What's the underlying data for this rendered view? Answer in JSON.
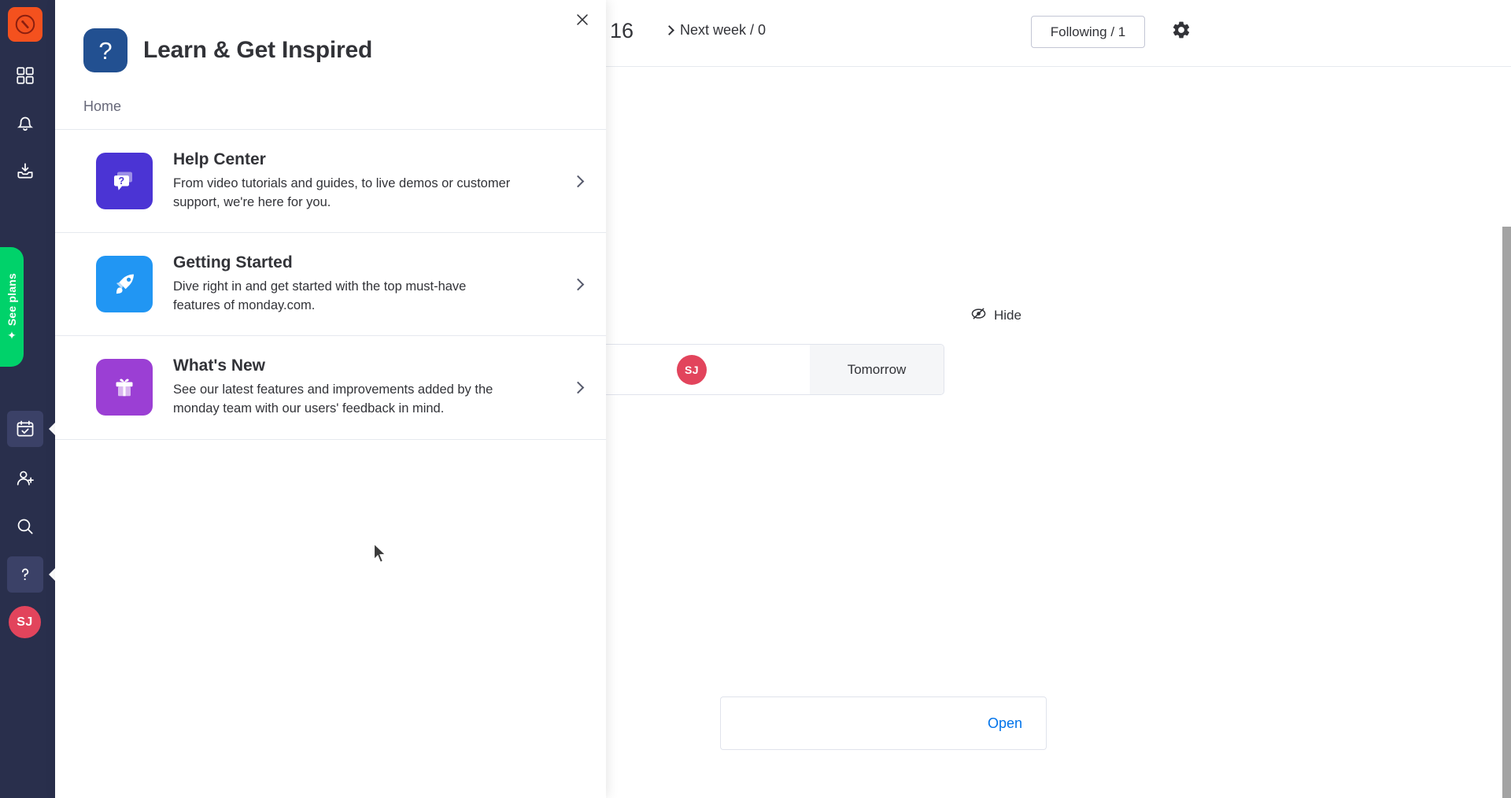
{
  "rail": {
    "logo_icon": "monday-logo-icon",
    "items": [
      {
        "name": "sidebar-item-home",
        "icon": "grid-icon",
        "active": false
      },
      {
        "name": "sidebar-item-notifications",
        "icon": "bell-icon",
        "active": false
      },
      {
        "name": "sidebar-item-inbox",
        "icon": "inbox-down-icon",
        "active": false
      },
      {
        "name": "sidebar-item-my-work",
        "icon": "calendar-check-icon",
        "active": true
      },
      {
        "name": "sidebar-item-invite",
        "icon": "user-plus-icon",
        "active": false
      },
      {
        "name": "sidebar-item-search",
        "icon": "search-icon",
        "active": false
      },
      {
        "name": "sidebar-item-help",
        "icon": "question-mark-icon",
        "active": true
      }
    ],
    "see_plans_label": "See plans",
    "see_plans_color": "#00d26a",
    "avatar_initials": "SJ",
    "avatar_color": "#e2445c"
  },
  "background": {
    "topbar": {
      "day_number": "16",
      "next_week_label": "Next week / 0",
      "following_label": "Following / 1",
      "gear_icon": "gear-icon"
    },
    "tomorrow_card": {
      "avatar_initials": "SJ",
      "due_label": "Tomorrow"
    },
    "hide_button": {
      "label": "Hide",
      "icon": "eye-slash-icon"
    },
    "open_card": {
      "open_label": "Open",
      "link_color": "#0073ea"
    }
  },
  "modal": {
    "close_icon": "close-icon",
    "header_icon": "question-mark-icon",
    "header_icon_color": "#225091",
    "title": "Learn & Get Inspired",
    "breadcrumb": "Home",
    "items": [
      {
        "title": "Help Center",
        "desc": "From video tutorials and guides, to live demos or customer support, we're here for you.",
        "icon": "chat-question-icon",
        "icon_color": "#4b34d4",
        "chevron": "chevron-right-icon"
      },
      {
        "title": "Getting Started",
        "desc": "Dive right in and get started with the top must-have features of monday.com.",
        "icon": "rocket-icon",
        "icon_color": "#2196f3",
        "chevron": "chevron-right-icon"
      },
      {
        "title": "What's New",
        "desc": "See our latest features and improvements added by the monday team with our users' feedback in mind.",
        "icon": "gift-icon",
        "icon_color": "#9b3fd4",
        "chevron": "chevron-right-icon"
      }
    ]
  }
}
